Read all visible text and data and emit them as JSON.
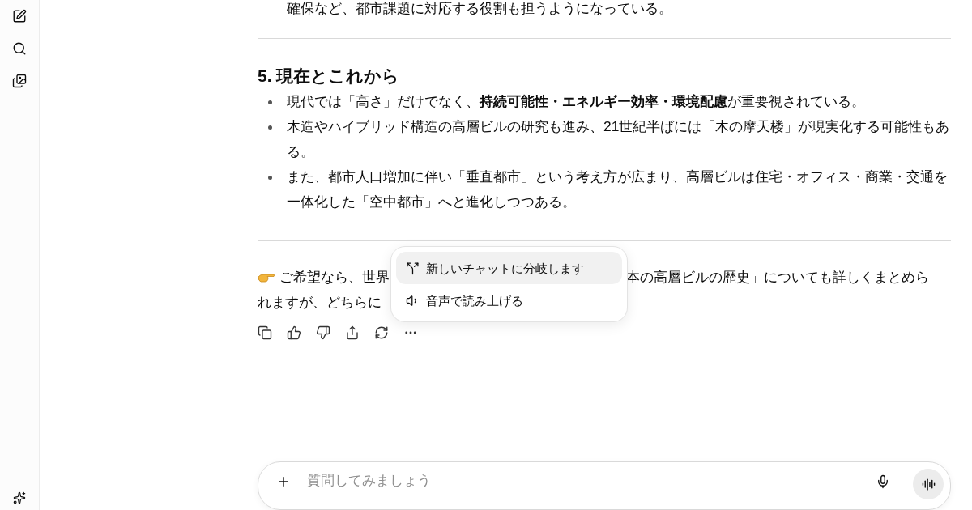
{
  "previous_text": "確保など、都市課題に対応する役割も担うようになっている。",
  "section": {
    "heading": "5. 現在とこれから",
    "bullets": [
      "現代では「高さ」だけでなく、**持続可能性・エネルギー効率・環境配慮**が重要視されている。",
      "木造やハイブリッド構造の高層ビルの研究も進み、21世紀半ばには「木の摩天楼」が現実化する可能性もある。",
      "また、都市人口増加に伴い「垂直都市」という考え方が広まり、高層ビルは住宅・オフィス・商業・交通を一体化した「空中都市」へと進化しつつある。"
    ]
  },
  "closing": {
    "line_1_left": "ご希望なら、世界",
    "line_1_right": "本の高層ビルの歴史」についても詳しくまとめら",
    "line_2": "れますが、どちらに"
  },
  "menu": {
    "items": [
      {
        "kind": "branch",
        "label": "新しいチャットに分岐します",
        "selected": true
      },
      {
        "kind": "speak",
        "label": "音声で読み上げる",
        "selected": false
      }
    ]
  },
  "composer": {
    "placeholder": "質問してみましょう"
  }
}
